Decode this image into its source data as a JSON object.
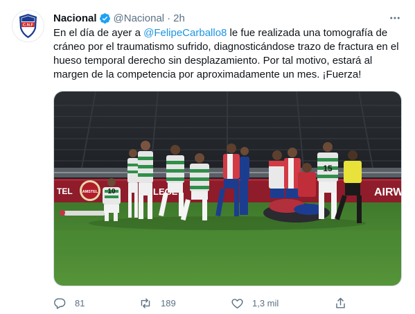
{
  "tweet": {
    "author_name": "Nacional",
    "handle": "@Nacional",
    "separator": "·",
    "time": "2h",
    "text_before": "En el día de ayer a ",
    "mention": "@FelipeCarballo8",
    "text_after": " le fue realizada una tomografía de cráneo  por el traumatismo sufrido, diagnosticándose trazo de fractura en el hueso temporal derecho sin desplazamiento. Por tal motivo, estará al margen de la competencia por aproximadamente un mes. ¡Fuerza!",
    "avatar_text": "C.N.F",
    "media": {
      "board_texts": [
        "TEL",
        "AMSTEL",
        "LEGE",
        "AIRW"
      ],
      "player_numbers": [
        "10",
        "15"
      ]
    }
  },
  "actions": {
    "reply_count": "81",
    "retweet_count": "189",
    "like_count": "1,3 mil"
  },
  "colors": {
    "link": "#1b95e0",
    "verified": "#1da1f2",
    "muted": "#5b7083",
    "nacional_blue": "#1c3d8f",
    "nacional_red": "#d2232a"
  },
  "icons": [
    "verified-badge-icon",
    "more-options-icon",
    "reply-icon",
    "retweet-icon",
    "like-icon",
    "share-icon"
  ]
}
